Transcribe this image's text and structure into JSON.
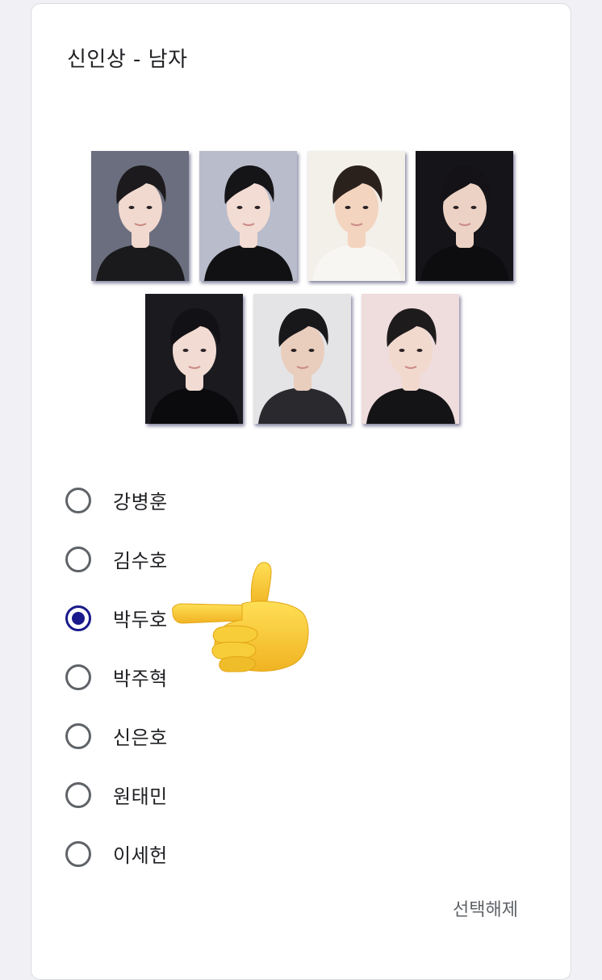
{
  "question": {
    "title": "신인상 - 남자"
  },
  "photos": [
    {
      "name": "candidate-photo-1",
      "bg": "#6b6e7e",
      "shirt": "#1a1a1d",
      "skin": "#f1d9cf",
      "hair": "#1c1a1c"
    },
    {
      "name": "candidate-photo-2",
      "bg": "#b9bccb",
      "shirt": "#111114",
      "skin": "#f3dcd3",
      "hair": "#151417"
    },
    {
      "name": "candidate-photo-3",
      "bg": "#f3efe9",
      "shirt": "#f8f6f2",
      "skin": "#f3d4bf",
      "hair": "#2a211c"
    },
    {
      "name": "candidate-photo-4",
      "bg": "#151419",
      "shirt": "#0d0d10",
      "skin": "#ecd2c4",
      "hair": "#141216"
    },
    {
      "name": "candidate-photo-5",
      "bg": "#1b1a1f",
      "shirt": "#0b0b0e",
      "skin": "#f1dbd2",
      "hair": "#121115"
    },
    {
      "name": "candidate-photo-6",
      "bg": "#e4e4e6",
      "shirt": "#2a2a2e",
      "skin": "#e9cdbd",
      "hair": "#18171a"
    },
    {
      "name": "candidate-photo-7",
      "bg": "#efdcdc",
      "shirt": "#141417",
      "skin": "#f2d9cd",
      "hair": "#1e1b1d"
    }
  ],
  "options": [
    {
      "label": "강병훈",
      "checked": false
    },
    {
      "label": "김수호",
      "checked": false
    },
    {
      "label": "박두호",
      "checked": true
    },
    {
      "label": "박주혁",
      "checked": false
    },
    {
      "label": "신은호",
      "checked": false
    },
    {
      "label": "원태민",
      "checked": false
    },
    {
      "label": "이세헌",
      "checked": false
    }
  ],
  "clear_label": "선택해제",
  "colors": {
    "accent": "#1a1a8c",
    "radio_border": "#5f6368",
    "hand_fill": "#f6c833",
    "hand_shade": "#e2a514"
  },
  "emoji": "backhand-index-pointing-left-icon"
}
